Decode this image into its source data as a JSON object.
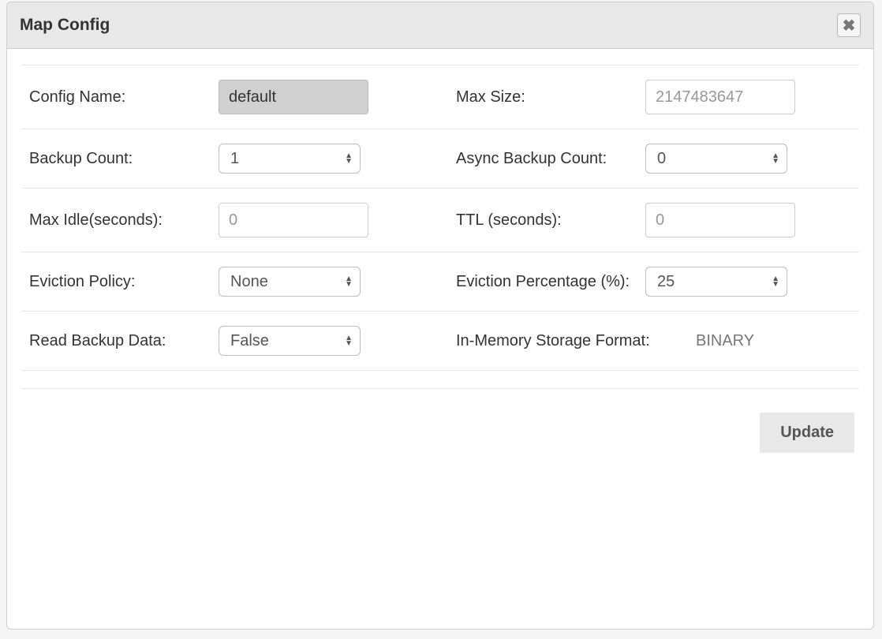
{
  "dialog": {
    "title": "Map Config"
  },
  "fields": {
    "configName": {
      "label": "Config Name:",
      "value": "default"
    },
    "maxSize": {
      "label": "Max Size:",
      "placeholder": "2147483647"
    },
    "backupCount": {
      "label": "Backup Count:",
      "value": "1"
    },
    "asyncBackupCount": {
      "label": "Async Backup Count:",
      "value": "0"
    },
    "maxIdle": {
      "label": "Max Idle(seconds):",
      "placeholder": "0"
    },
    "ttl": {
      "label": "TTL (seconds):",
      "placeholder": "0"
    },
    "evictionPolicy": {
      "label": "Eviction Policy:",
      "value": "None"
    },
    "evictionPercentage": {
      "label": "Eviction Percentage (%):",
      "value": "25"
    },
    "readBackupData": {
      "label": "Read Backup Data:",
      "value": "False"
    },
    "inMemoryFormat": {
      "label": "In-Memory Storage Format:",
      "value": "BINARY"
    }
  },
  "buttons": {
    "update": "Update"
  }
}
